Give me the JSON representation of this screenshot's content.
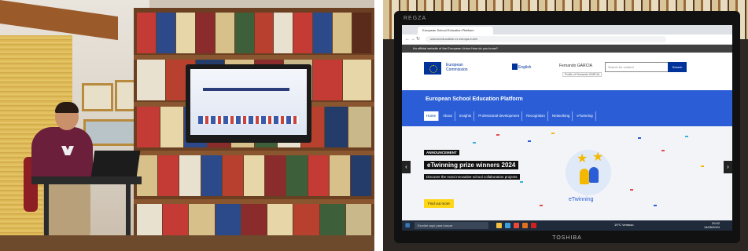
{
  "left_photo": {
    "description_icons": [
      "person-with-laptop",
      "bookshelf",
      "wall-tv"
    ]
  },
  "monitor": {
    "brand_top": "REGZA",
    "brand_bottom": "TOSHIBA"
  },
  "browser": {
    "tab_title": "European School Education Platform",
    "address": "school-education.ec.europa.eu/en",
    "official_bar": "An official website of the European Union   How do you know?"
  },
  "site_header": {
    "ec_name_line1": "European",
    "ec_name_line2": "Commission",
    "language": "English",
    "user": "Fernando GARCIA",
    "user_tooltip": "Profile of Fernando GARCIA",
    "search_placeholder": "Search for content",
    "search_button": "Search"
  },
  "platform": {
    "title": "European School Education Platform",
    "menu": [
      "Home",
      "About",
      "Insights",
      "Professional development",
      "Recognition",
      "Networking",
      "eTwinning"
    ]
  },
  "hero": {
    "tag": "ANNOUNCEMENT",
    "title": "eTwinning prize winners 2024",
    "subtitle": "Discover the most innovative school collaboration projects",
    "button": "Find out more",
    "badge_label": "eTwinning"
  },
  "taskbar": {
    "search": "Escribe aquí para buscar",
    "weather": "19°C  Ventoso",
    "time": "20:02",
    "date": "14/05/2024"
  },
  "colors": {
    "ec_blue": "#003399",
    "platform_blue": "#2a5dd6",
    "cta_yellow": "#ffd617"
  }
}
